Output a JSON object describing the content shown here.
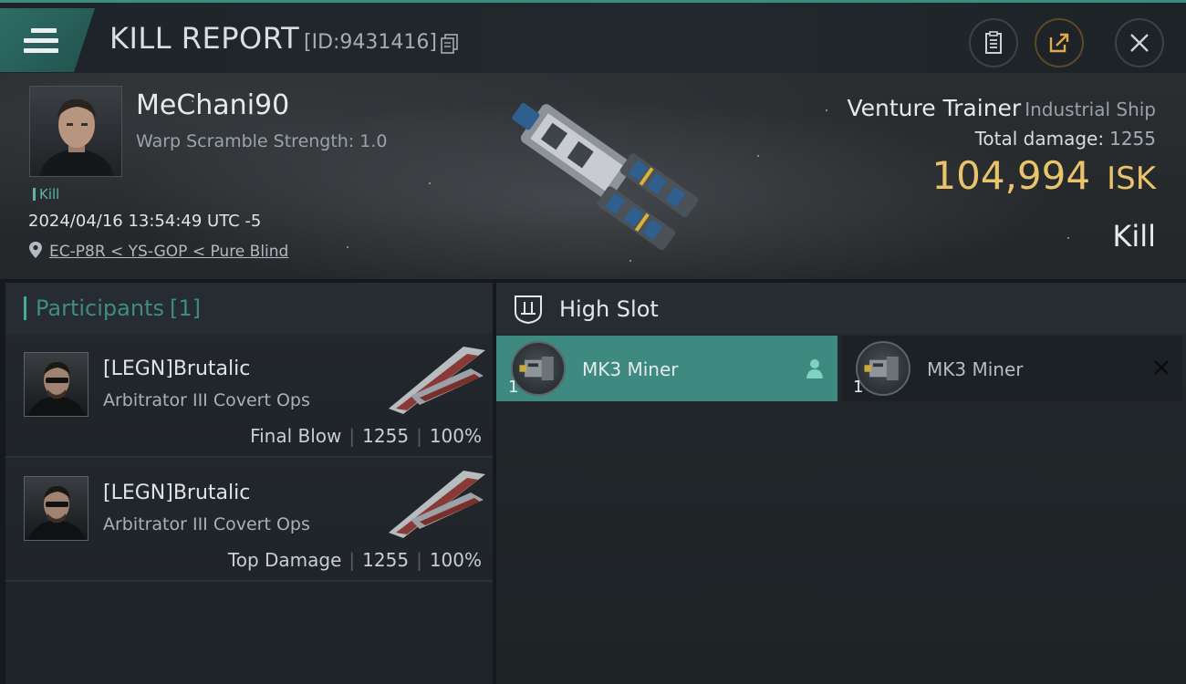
{
  "header": {
    "title": "KILL REPORT",
    "report_id": "[ID:9431416]",
    "icons": {
      "menu": "menu-icon",
      "copy": "copy-icon",
      "clipboard": "clipboard-icon",
      "share": "share-icon",
      "close": "close-icon"
    }
  },
  "victim": {
    "pilot_name": "MeChani90",
    "warp_scramble": "Warp Scramble Strength: 1.0",
    "kill_tag": "Kill",
    "datetime": "2024/04/16 13:54:49 UTC -5",
    "location": "EC-P8R < YS-GOP < Pure Blind",
    "ship_name": "Venture Trainer",
    "ship_class": "Industrial Ship",
    "total_damage_label": "Total damage:",
    "total_damage_value": "1255",
    "isk_value": "104,994",
    "isk_unit": "ISK",
    "result": "Kill"
  },
  "participants": {
    "label": "Participants",
    "count": "[1]",
    "rows": [
      {
        "name": "[LEGN]Brutalic",
        "ship": "Arbitrator III Covert Ops",
        "role": "Final Blow",
        "damage": "1255",
        "percent": "100%"
      },
      {
        "name": "[LEGN]Brutalic",
        "ship": "Arbitrator III Covert Ops",
        "role": "Top Damage",
        "damage": "1255",
        "percent": "100%"
      }
    ]
  },
  "fitting": {
    "slot_label": "High Slot",
    "modules": [
      {
        "name": "MK3 Miner",
        "qty": "1",
        "state": "dropped"
      },
      {
        "name": "MK3 Miner",
        "qty": "1",
        "state": "destroyed"
      }
    ]
  },
  "colors": {
    "accent": "#3e8a80",
    "isk": "#e9c46a",
    "participants_label": "#3f8c82"
  }
}
